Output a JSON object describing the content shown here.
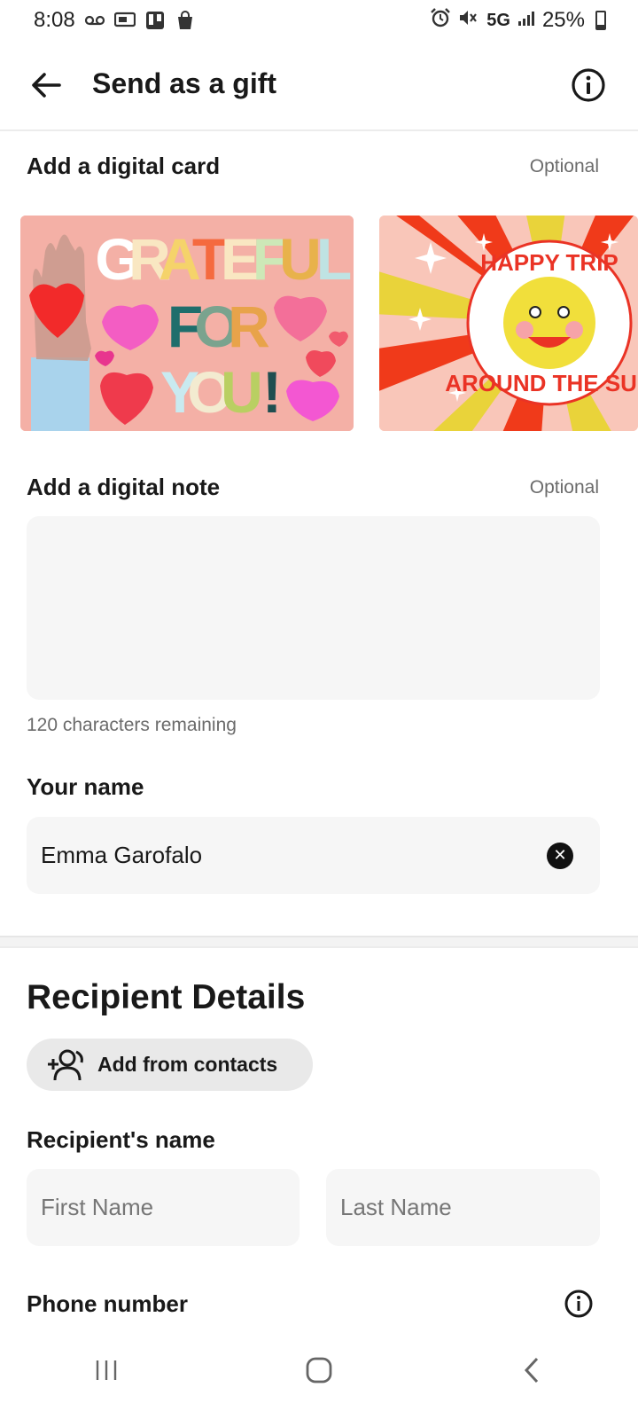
{
  "status_bar": {
    "time": "8:08",
    "network": "5G",
    "battery_percent": "25%",
    "battery_level": 0.25,
    "icons": [
      "voicemail-icon",
      "screencast-icon",
      "trello-icon",
      "bag-icon",
      "alarm-icon",
      "mute-icon",
      "signal-icon",
      "battery-icon"
    ]
  },
  "app_bar": {
    "title": "Send as a gift",
    "back_icon": "arrow-left-icon",
    "info_icon": "info-icon"
  },
  "digital_card": {
    "title": "Add a digital card",
    "optional": "Optional",
    "cards": [
      {
        "text_lines": [
          "GRATEFUL",
          "FOR",
          "YOU!"
        ]
      },
      {
        "text_top": "HAPPY TRIP",
        "text_bottom": "AROUND THE SUN"
      }
    ]
  },
  "digital_note": {
    "title": "Add a digital note",
    "optional": "Optional",
    "value": "",
    "chars_remaining": "120 characters remaining"
  },
  "your_name": {
    "label": "Your name",
    "value": "Emma Garofalo"
  },
  "recipient": {
    "title": "Recipient Details",
    "add_contacts": "Add from contacts",
    "name_label": "Recipient's name",
    "first_placeholder": "First Name",
    "last_placeholder": "Last Name",
    "phone_label": "Phone number"
  },
  "colors": {
    "field_bg": "#f6f6f6",
    "text": "#191919",
    "muted": "#6b6b6b"
  }
}
